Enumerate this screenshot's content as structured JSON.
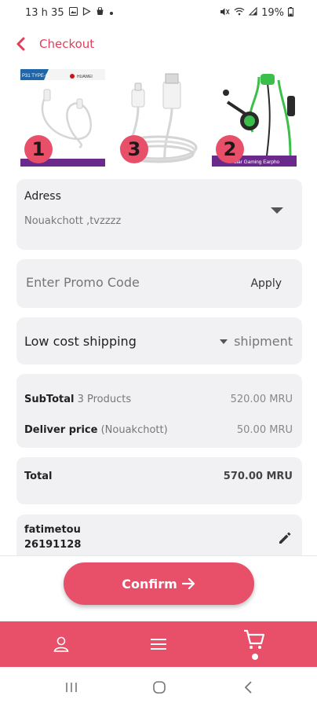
{
  "status_bar": {
    "time": "13 h 35",
    "battery": "19%"
  },
  "header": {
    "title": "Checkout"
  },
  "products": [
    {
      "number": "1",
      "image": "usb-type-c-cable-huawei",
      "label": "P31 TYPE-C"
    },
    {
      "number": "3",
      "image": "usb-cable-coiled"
    },
    {
      "number": "2",
      "image": "gaming-earphones-green",
      "label": "ular Gaming Earpho"
    }
  ],
  "address": {
    "label": "Adress",
    "value": "Nouakchott ,tvzzzz"
  },
  "promo": {
    "placeholder": "Enter Promo Code",
    "apply_label": "Apply"
  },
  "shipping": {
    "label": "Low cost shipping",
    "selected": "shipment"
  },
  "totals": {
    "subtotal_label": "SubTotal",
    "subtotal_count": "3 Products",
    "subtotal_value": "520.00 MRU",
    "delivery_label": "Deliver price",
    "delivery_city": "(Nouakchott)",
    "delivery_value": "50.00 MRU",
    "total_label": "Total",
    "total_value": "570.00 MRU"
  },
  "contact": {
    "name": "fatimetou",
    "phone": "26191128"
  },
  "confirm": {
    "label": "Confirm"
  },
  "bottom_nav": {
    "items": [
      "profile-icon",
      "menu-icon",
      "cart-icon"
    ],
    "active": "cart-icon"
  },
  "colors": {
    "accent": "#e8506a",
    "card_bg": "#f1f1f3",
    "earphone_green": "#3bbf4a"
  }
}
